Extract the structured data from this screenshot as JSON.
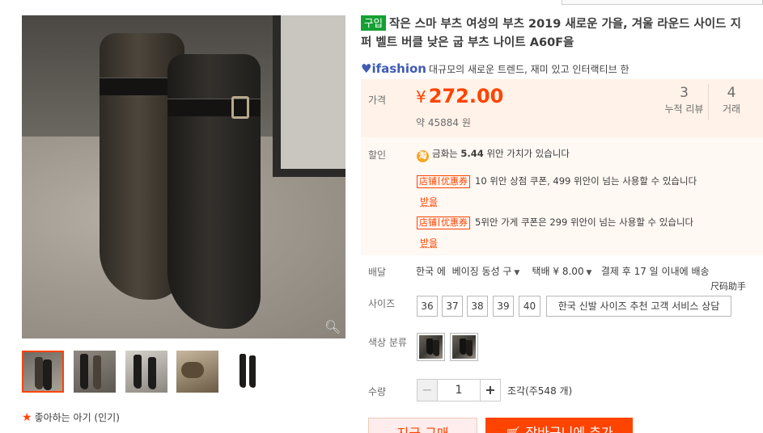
{
  "gallery": {
    "thumbnails": [
      "thumb-1",
      "thumb-2",
      "thumb-3",
      "thumb-4",
      "thumb-5"
    ],
    "favorite_label": "좋아하는 아기 (인기)",
    "zoom_icon": "magnifier-icon"
  },
  "product": {
    "buy_tag": "구입",
    "title": "작은 스마 부츠 여성의 부츠 2019 새로운 가을, 겨울 라운드 사이드 지퍼 벨트 버클 낮은 굽 부츠 나이트 A60F을",
    "brand_logo": "ifashion",
    "brand_slogan": "대규모의 새로운 트렌드, 재미 있고 인터랙티브 한"
  },
  "price": {
    "label": "가격",
    "currency": "¥",
    "value": "272.00",
    "approx": "약 45884 원",
    "reviews_count": "3",
    "reviews_label": "누적 리뷰",
    "trades_count": "4",
    "trades_label": "거래"
  },
  "promo": {
    "label": "할인",
    "gold_prefix": "금화는",
    "gold_value": "5.44",
    "gold_suffix": "위안 가치가 있습니다",
    "coupon_tag_left": "店铺",
    "coupon_tag_right": "优惠券",
    "coupon1_text": "10 위안 상점 쿠폰, 499 위안이 넘는 사용할 수 있습니다",
    "coupon2_text": "5위안 가게 쿠폰은 299 위안이 넘는 사용할 수 있습니다",
    "get_label": "받을"
  },
  "shipping": {
    "label": "배달",
    "from": "한국 에",
    "to": "베이징 동성 구",
    "fee": "택배 ¥ 8.00",
    "eta": "결제 후 17 일 이내에 배송",
    "cn_note": "尺码助手"
  },
  "sizes": {
    "label": "사이즈",
    "options": [
      "36",
      "37",
      "38",
      "39",
      "40"
    ],
    "help": "한국 신발 사이즈 추천 고객 서비스 상담"
  },
  "colors": {
    "label": "색상 분류"
  },
  "quantity": {
    "label": "수량",
    "value": "1",
    "minus": "−",
    "plus": "+",
    "stock": "조각(주548 개)"
  },
  "actions": {
    "buy_now": "지금 구매",
    "add_to_cart": "장바구니에 추가"
  },
  "colors_theme": {
    "accent": "#ff4400",
    "tag_green": "#14a033",
    "price_bg": "#fff2e8"
  }
}
